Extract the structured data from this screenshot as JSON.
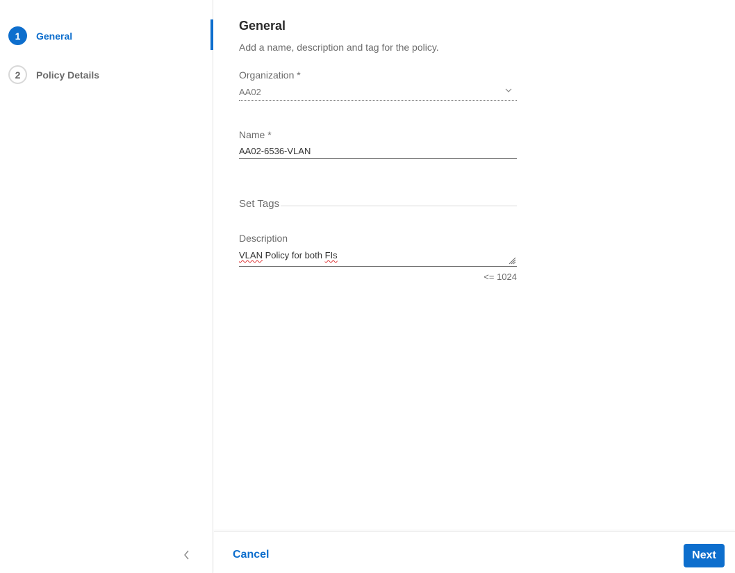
{
  "wizard": {
    "steps": [
      {
        "number": "1",
        "label": "General",
        "state": "active"
      },
      {
        "number": "2",
        "label": "Policy Details",
        "state": "inactive"
      }
    ],
    "collapse_icon": "chevron-left-icon"
  },
  "form": {
    "title": "General",
    "subtitle": "Add a name, description and tag for the policy.",
    "organization": {
      "label": "Organization *",
      "value": "AA02",
      "icon": "chevron-down-icon"
    },
    "name": {
      "label": "Name *",
      "value": "AA02-6536-VLAN"
    },
    "tags": {
      "label": "Set Tags"
    },
    "description": {
      "label": "Description",
      "value": "VLAN Policy for both FIs",
      "value_parts": [
        "VLAN",
        " Policy for both ",
        "FIs"
      ],
      "char_limit": "<= 1024"
    }
  },
  "footer": {
    "cancel_label": "Cancel",
    "next_label": "Next"
  },
  "colors": {
    "accent": "#0d6ecd",
    "muted_text": "#6b6b6b"
  }
}
